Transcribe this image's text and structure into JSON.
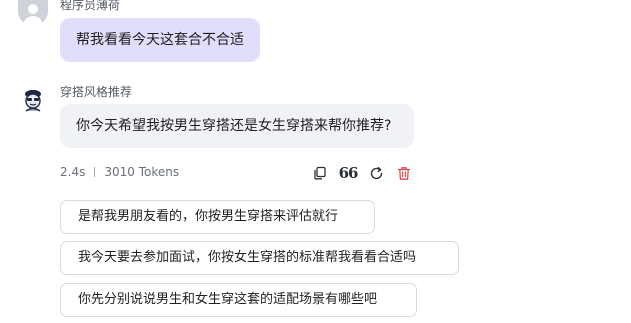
{
  "user": {
    "name": "程序员薄荷",
    "message": "帮我看看今天这套合不合适"
  },
  "bot": {
    "name": "穿搭风格推荐",
    "message": "你今天希望我按男生穿搭还是女生穿搭来帮你推荐?"
  },
  "meta": {
    "duration": "2.4s",
    "tokens": "3010 Tokens"
  },
  "actions": {
    "quote_glyph": "66",
    "icons": [
      "copy-icon",
      "quote-icon",
      "regenerate-icon",
      "delete-icon"
    ],
    "delete_color": "#e5484d"
  },
  "suggestions": [
    "是帮我男朋友看的，你按男生穿搭来评估就行",
    "我今天要去参加面试，你按女生穿搭的标准帮我看看合适吗",
    "你先分别说说男生和女生穿这套的适配场景有哪些吧"
  ],
  "colors": {
    "user_bubble": "#e1defc",
    "bot_bubble": "#f1f2f5"
  }
}
